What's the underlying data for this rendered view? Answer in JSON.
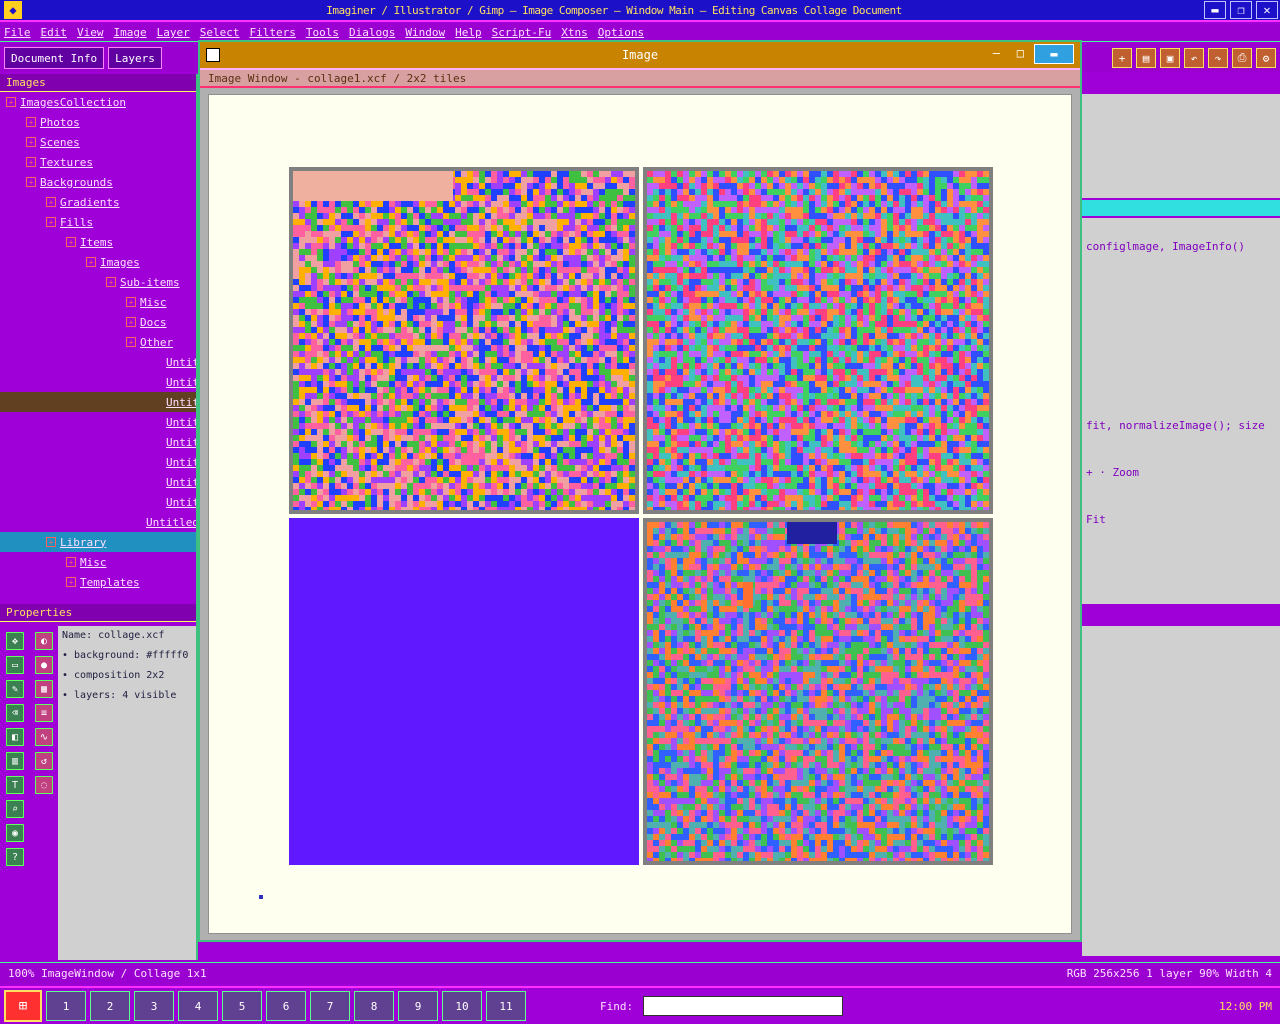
{
  "window": {
    "title": "Imaginer / Illustrator / Gimp — Image Composer — Window Main — Editing Canvas Collage Document",
    "minimize_label": "▬",
    "restore_label": "❐",
    "close_label": "✕"
  },
  "menubar": {
    "items": [
      "File",
      "Edit",
      "View",
      "Image",
      "Layer",
      "Select",
      "Filters",
      "Tools",
      "Dialogs",
      "Window",
      "Help",
      "Script-Fu",
      "Xtns",
      "Options"
    ]
  },
  "toolbar": {
    "buttons": [
      {
        "label": "Document Info",
        "icon": "document-icon"
      },
      {
        "label": "Layers",
        "icon": "layers-icon"
      }
    ]
  },
  "tree": {
    "header": "Images",
    "items": [
      {
        "label": "ImagesCollection",
        "depth": 0,
        "state": "normal"
      },
      {
        "label": "Photos",
        "depth": 1,
        "state": "normal"
      },
      {
        "label": "Scenes",
        "depth": 1,
        "state": "normal"
      },
      {
        "label": "Textures",
        "depth": 1,
        "state": "normal"
      },
      {
        "label": "Backgrounds",
        "depth": 1,
        "state": "normal"
      },
      {
        "label": "Gradients",
        "depth": 2,
        "state": "normal"
      },
      {
        "label": "Fills",
        "depth": 2,
        "state": "normal"
      },
      {
        "label": "Items",
        "depth": 3,
        "state": "normal"
      },
      {
        "label": "Images",
        "depth": 4,
        "state": "normal"
      },
      {
        "label": "Sub-items",
        "depth": 5,
        "state": "normal"
      },
      {
        "label": "Misc",
        "depth": 6,
        "state": "normal"
      },
      {
        "label": "Docs",
        "depth": 6,
        "state": "normal"
      },
      {
        "label": "Other",
        "depth": 6,
        "state": "normal"
      },
      {
        "label": "Untitled",
        "depth": 8,
        "state": "normal"
      },
      {
        "label": "Untitled",
        "depth": 8,
        "state": "normal"
      },
      {
        "label": "Untitled",
        "depth": 8,
        "state": "dark"
      },
      {
        "label": "Untitled",
        "depth": 8,
        "state": "normal"
      },
      {
        "label": "Untitled",
        "depth": 8,
        "state": "normal"
      },
      {
        "label": "Untitled",
        "depth": 8,
        "state": "normal"
      },
      {
        "label": "Untitled",
        "depth": 8,
        "state": "normal"
      },
      {
        "label": "Untitled",
        "depth": 8,
        "state": "normal"
      },
      {
        "label": "Untitled",
        "depth": 7,
        "state": "normal"
      },
      {
        "label": "Library",
        "depth": 2,
        "state": "selected"
      },
      {
        "label": "Misc",
        "depth": 3,
        "state": "normal"
      },
      {
        "label": "Templates",
        "depth": 3,
        "state": "normal"
      }
    ]
  },
  "properties": {
    "header": "Properties",
    "rows": [
      "Name: collage.xcf",
      "• background: #fffff0",
      "• composition 2x2",
      "• layers: 4 visible"
    ],
    "tool_labels": [
      "move-icon",
      "select-icon",
      "brush-icon",
      "eraser-icon",
      "fill-icon",
      "gradient-icon",
      "text-icon",
      "zoom-icon",
      "color-icon",
      "help-icon"
    ]
  },
  "right_panel": {
    "line1": "configlmage, ImageInfo()",
    "line2": "fit, normalizeImage(); size",
    "line3": "+  ·  Zoom",
    "line4": "Fit"
  },
  "dialog": {
    "title": "Image",
    "path": "Image Window - collage1.xcf / 2x2 tiles",
    "tiles": [
      {
        "name": "tile-top-left",
        "kind": "noise",
        "palette": [
          "#ff60a0",
          "#40c040",
          "#2040ff",
          "#ffb000",
          "#f0a0a0",
          "#a040ff"
        ]
      },
      {
        "name": "tile-top-right",
        "kind": "noise",
        "palette": [
          "#ff4080",
          "#40d060",
          "#3050ff",
          "#ff9040",
          "#c060ff",
          "#40c0c0"
        ]
      },
      {
        "name": "tile-bottom-left",
        "kind": "solid",
        "color": "#6018ff"
      },
      {
        "name": "tile-bottom-right",
        "kind": "noise",
        "palette": [
          "#ff6090",
          "#40c050",
          "#3060ff",
          "#ff8030",
          "#a050ff",
          "#50b0b0"
        ]
      }
    ]
  },
  "statusbar": {
    "left": "100% ImageWindow / Collage 1x1",
    "right": "RGB 256x256 1 layer 90% Width 4"
  },
  "taskbar": {
    "start_label": "⊞",
    "tasks": [
      "1",
      "2",
      "3",
      "4",
      "5",
      "6",
      "7",
      "8",
      "9",
      "10",
      "11"
    ],
    "search_label": "Find:",
    "clock": "12:00 PM"
  },
  "colors": {
    "accent": "#a000d8",
    "titlebar": "#1c10c8",
    "dialog_title": "#c88400",
    "canvas_bg": "#fffff0",
    "solid_tile": "#6018ff"
  }
}
